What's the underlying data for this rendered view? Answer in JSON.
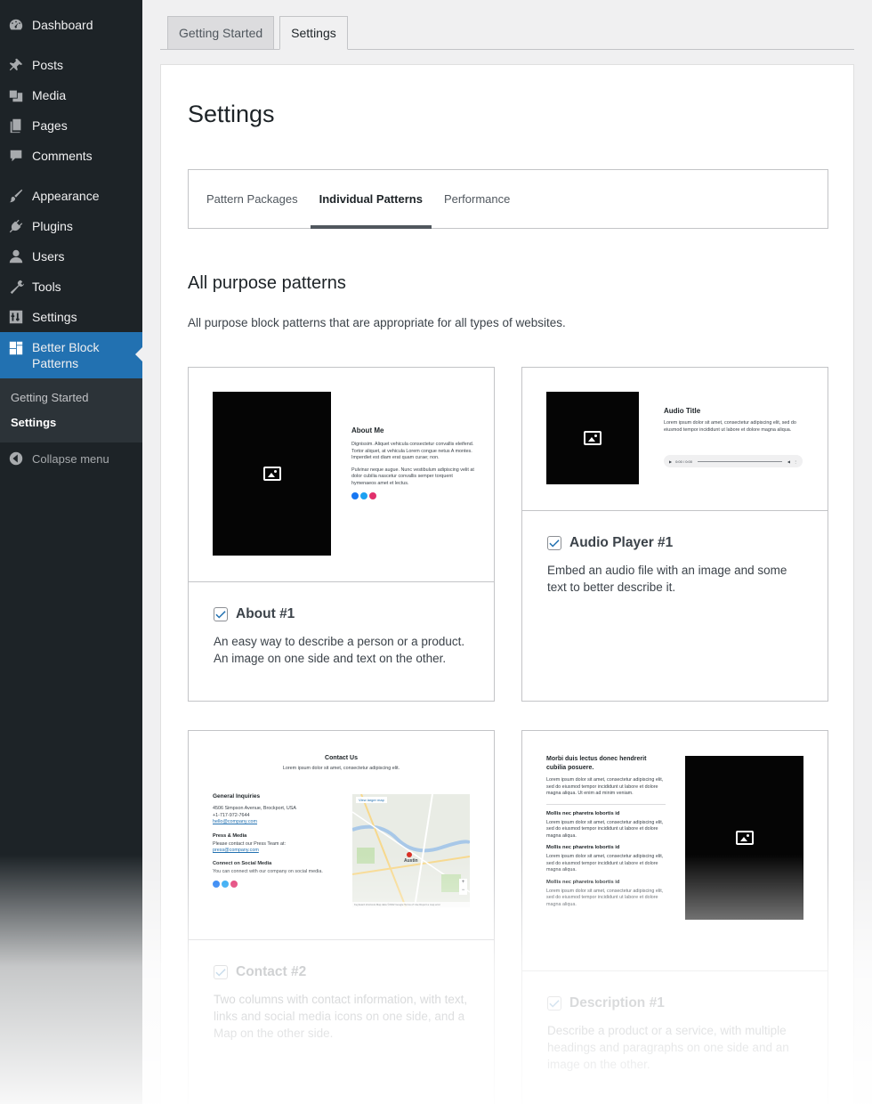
{
  "sidebar": {
    "items": [
      {
        "label": "Dashboard",
        "icon": "dashboard-icon"
      },
      {
        "label": "Posts",
        "icon": "pin-icon"
      },
      {
        "label": "Media",
        "icon": "media-icon"
      },
      {
        "label": "Pages",
        "icon": "pages-icon"
      },
      {
        "label": "Comments",
        "icon": "comment-icon"
      },
      {
        "label": "Appearance",
        "icon": "brush-icon"
      },
      {
        "label": "Plugins",
        "icon": "plug-icon"
      },
      {
        "label": "Users",
        "icon": "user-icon"
      },
      {
        "label": "Tools",
        "icon": "wrench-icon"
      },
      {
        "label": "Settings",
        "icon": "sliders-icon"
      },
      {
        "label": "Better Block Patterns",
        "icon": "grid-icon"
      }
    ],
    "submenu": [
      "Getting Started",
      "Settings"
    ],
    "collapse_label": "Collapse menu"
  },
  "top_tabs": [
    "Getting Started",
    "Settings"
  ],
  "page_title": "Settings",
  "inner_tabs": [
    "Pattern Packages",
    "Individual Patterns",
    "Performance"
  ],
  "section": {
    "title": "All purpose patterns",
    "description": "All purpose block patterns that are appropriate for all types of websites."
  },
  "cards": [
    {
      "title": "About #1",
      "description": "An easy way to describe a person or a product. An image on one side and text on the other.",
      "checked": true,
      "preview": {
        "heading": "About Me",
        "para1": "Dignissim. Aliquet vehicula consectetur convallis eleifend. Tortor aliquet, at vehicula Lorem congue netus A montes. Imperdiet est diam erat quam curae; non.",
        "para2": "Pulvinar neque augue. Nunc vestibulum adipiscing velit at dolor cubilia nascetur convallis semper torquent hymenaeos amet et lectus."
      }
    },
    {
      "title": "Audio Player #1",
      "description": "Embed an audio file with an image and some text to better describe it.",
      "checked": true,
      "preview": {
        "heading": "Audio Title",
        "para": "Lorem ipsum dolor sit amet, consectetur adipiscing elit, sed do eiusmod tempor incididunt ut labore et dolore magna aliqua.",
        "time": "0:00 / 0:00"
      }
    },
    {
      "title": "Contact #2",
      "description": "Two columns with contact information, with text, links and social media icons on one side, and a Map on the other side.",
      "checked": true,
      "preview": {
        "heading": "Contact Us",
        "sub": "Lorem ipsum dolor sit amet, consectetur adipiscing elit.",
        "general": "General Inquiries",
        "address": "4506 Simpson Avenue, Brockport, USA",
        "phone": "+1-717-972-7644",
        "email": "hello@company.com",
        "press": "Press & Media",
        "press_text": "Please contact our Press Team at:",
        "press_email": "press@company.com",
        "social": "Connect on Social Media",
        "social_text": "You can connect with our company on social media.",
        "map_button": "View larger map",
        "map_city": "Austin",
        "map_footer": "Keyboard shortcuts   Map data ©2022 Google   Terms of Use   Report a map error"
      }
    },
    {
      "title": "Description #1",
      "description": "Describe a product or a service, with multiple headings and paragraphs on one side and an image on the other.",
      "checked": true,
      "preview": {
        "heading": "Morbi duis lectus donec hendrerit cubilia posuere.",
        "para": "Lorem ipsum dolor sit amet, consectetur adipiscing elit, sed do eiusmod tempor incididunt ut labore et dolore magna aliqua. Ut enim ad minim veniam.",
        "sub1": "Mollis nec pharetra lobortis id",
        "sub_para": "Lorem ipsum dolor sit amet, consectetur adipiscing elit, sed do eiusmod tempor incididunt ut labore et dolore magna aliqua.",
        "sub2": "Mollis nec pharetra lobortis id",
        "sub3": "Mollis nec pharetra lobortis id"
      }
    }
  ],
  "colors": {
    "sidebar_bg": "#1d2327",
    "accent": "#2271b1",
    "facebook": "#1877f2",
    "twitter": "#1da1f2",
    "instagram": "#e1306c"
  }
}
